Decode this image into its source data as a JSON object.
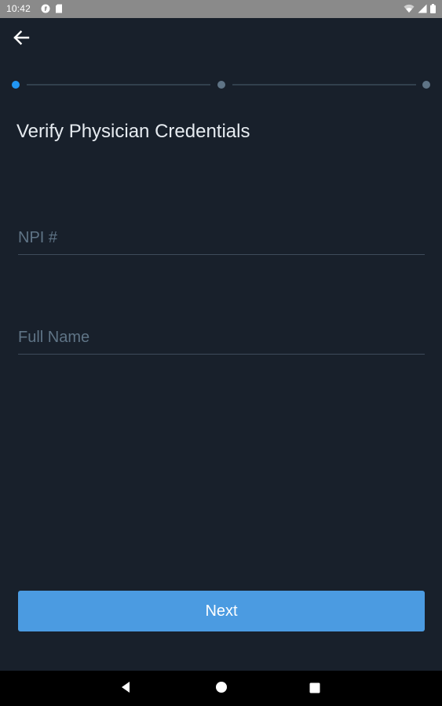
{
  "status_bar": {
    "time": "10:42",
    "left_icons": [
      "notification-f-icon",
      "sd-card-icon"
    ],
    "right_icons": [
      "wifi-icon",
      "signal-icon",
      "battery-icon"
    ]
  },
  "header": {
    "back_icon": "arrow-left-icon"
  },
  "stepper": {
    "total_steps": 3,
    "current_step": 1,
    "active_color": "#2196f3",
    "inactive_color": "#5f7486"
  },
  "page": {
    "title": "Verify Physician Credentials"
  },
  "form": {
    "npi": {
      "placeholder": "NPI #",
      "value": ""
    },
    "full_name": {
      "placeholder": "Full Name",
      "value": ""
    }
  },
  "actions": {
    "next_label": "Next",
    "next_color": "#4b9be1"
  },
  "nav_bar": {
    "icons": [
      "nav-back-icon",
      "nav-home-icon",
      "nav-recents-icon"
    ]
  },
  "colors": {
    "background": "#18202b",
    "status_bar": "#8a8a8a",
    "nav_bar": "#000000",
    "title_text": "#e6ebf0",
    "placeholder_text": "#5f7486",
    "divider": "#3e4b5a"
  }
}
